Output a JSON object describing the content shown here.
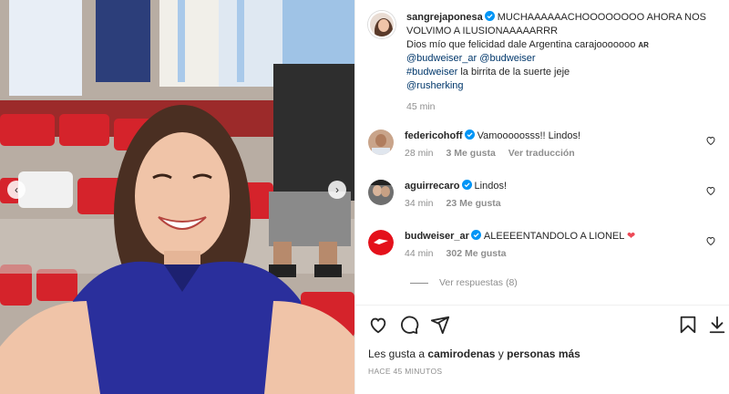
{
  "post": {
    "username": "sangrejaponesa",
    "caption_line1": "MUCHAAAAAACHOOOOOOOO AHORA NOS",
    "caption_line2": "VOLVIMO A ILUSIONAAAAARRR",
    "caption_line3": "Dios mío que felicidad dale Argentina carajooooooo",
    "flag_label": "AR",
    "mention1": "@budweiser_ar",
    "mention2": "@budweiser",
    "hashtag": "#budweiser",
    "caption_tail": "la birrita de la suerte jeje",
    "mention3": "@rusherking",
    "time": "45 min"
  },
  "comments": [
    {
      "username": "federicohoff",
      "text": "Vamooooosss!! Lindos!",
      "time": "28 min",
      "likes": "3 Me gusta",
      "translate": "Ver traducción"
    },
    {
      "username": "aguirrecaro",
      "text": "Lindos!",
      "time": "34 min",
      "likes": "23 Me gusta"
    },
    {
      "username": "budweiser_ar",
      "text": "ALEEEENTANDOLO A LIONEL",
      "emoji": "❤",
      "time": "44 min",
      "likes": "302 Me gusta"
    }
  ],
  "view_replies": "Ver respuestas (8)",
  "likes_prefix": "Les gusta a",
  "likes_user": "camirodenas",
  "likes_conj": "y",
  "likes_suffix": "personas más",
  "timestamp": "HACE 45 MINUTOS",
  "icons": {
    "verified": "verified-badge-icon",
    "heart": "heart-icon",
    "comment": "comment-icon",
    "share": "share-icon",
    "save": "bookmark-icon",
    "download": "download-icon"
  },
  "colors": {
    "verified": "#0095f6",
    "link": "#00376b",
    "muted": "#8e8e8e",
    "red_heart": "#ed4956"
  }
}
